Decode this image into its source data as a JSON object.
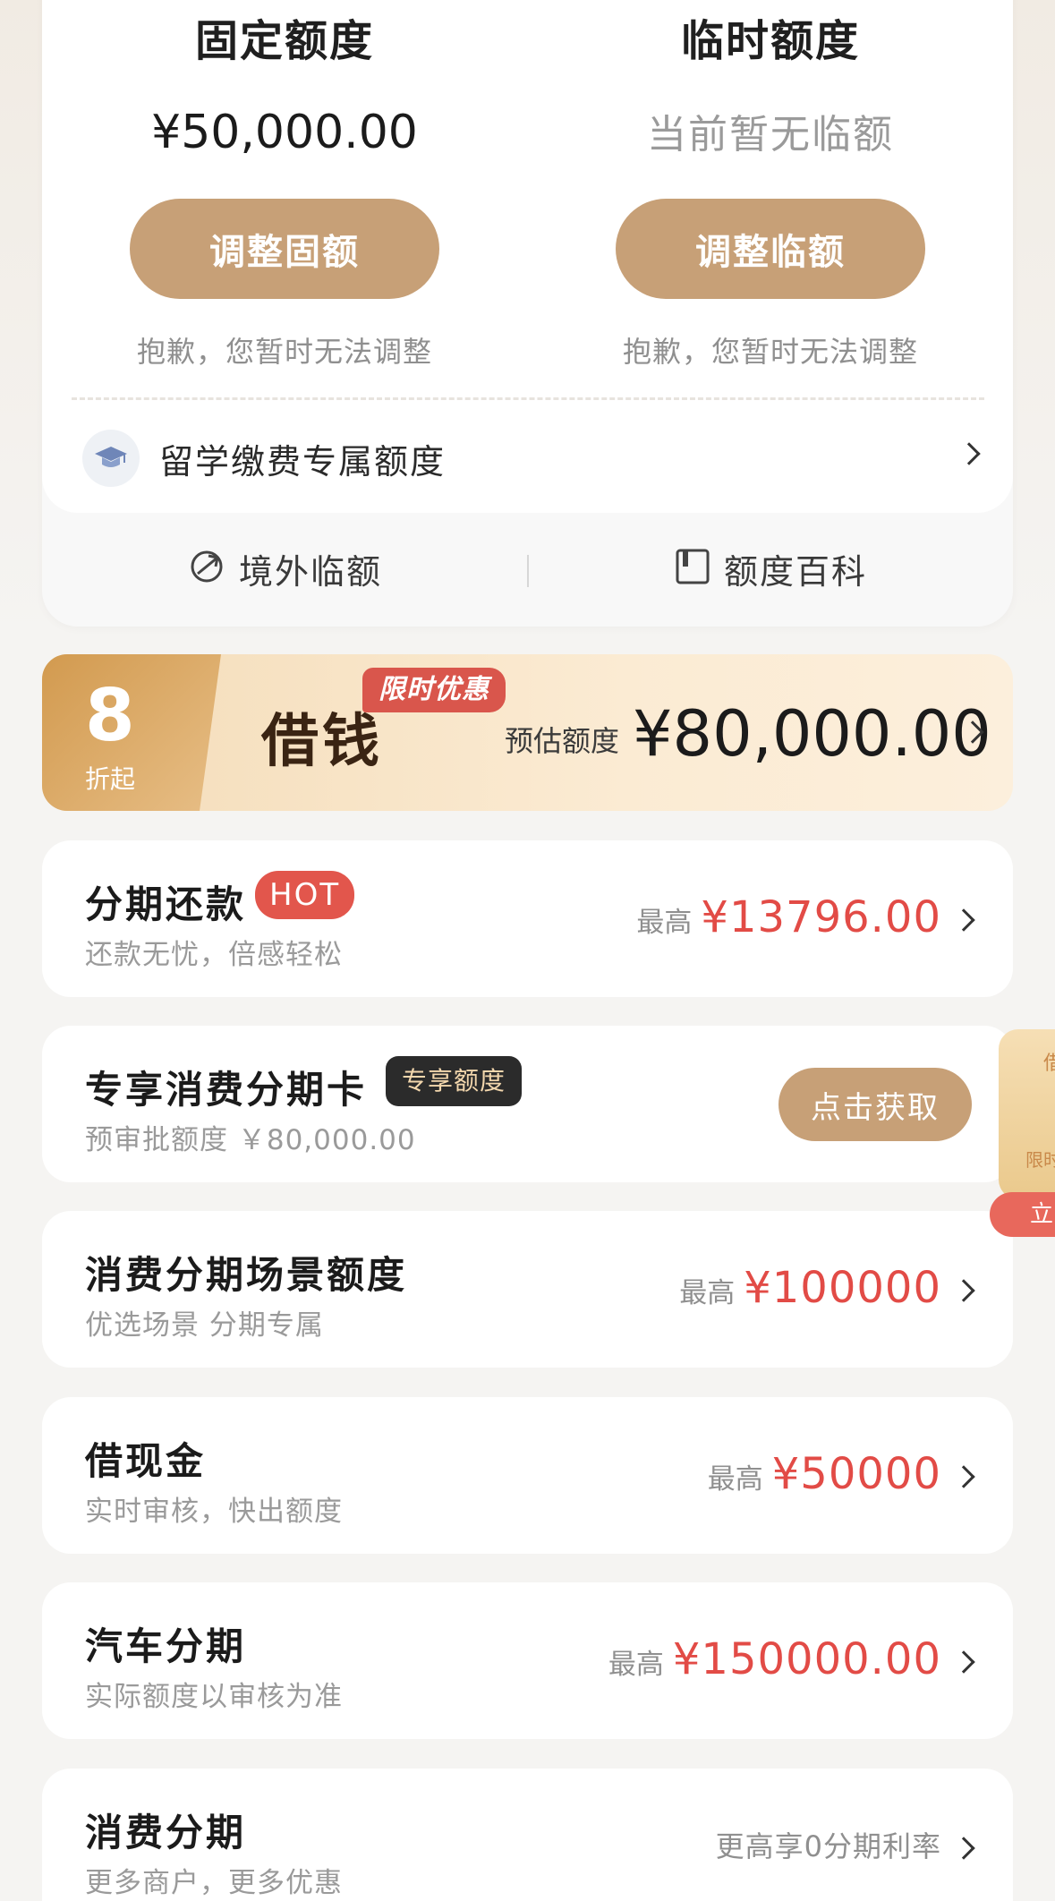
{
  "limits": {
    "fixed": {
      "title": "固定额度",
      "amount": "¥50,000.00",
      "button": "调整固额",
      "note": "抱歉，您暂时无法调整"
    },
    "temporary": {
      "title": "临时额度",
      "amount": "当前暂无临额",
      "button": "调整临额",
      "note": "抱歉，您暂时无法调整"
    },
    "study_row": {
      "label": "留学缴费专属额度",
      "icon": "graduation-cap-icon"
    },
    "quick_links": [
      {
        "label": "境外临额",
        "icon": "plane-globe-icon"
      },
      {
        "label": "额度百科",
        "icon": "book-icon"
      }
    ]
  },
  "loan_banner": {
    "discount_number": "8",
    "discount_label": "折起",
    "title": "借钱",
    "promo_badge": "限时优惠",
    "estimate_label": "预估额度",
    "estimate_value": "¥80,000.00"
  },
  "products": [
    {
      "title": "分期还款",
      "badge": "HOT",
      "subtitle": "还款无忧，倍感轻松",
      "right_label": "最高",
      "right_value": "¥13796.00"
    },
    {
      "title": "专享消费分期卡",
      "badge": "专享额度",
      "subtitle": "预审批额度 ￥80,000.00",
      "button": "点击获取"
    },
    {
      "title": "消费分期场景额度",
      "subtitle": "优选场景 分期专属",
      "right_label": "最高",
      "right_value": "¥100000"
    },
    {
      "title": "借现金",
      "subtitle": "实时审核，快出额度",
      "right_label": "最高",
      "right_value": "¥50000"
    },
    {
      "title": "汽车分期",
      "subtitle": "实际额度以审核为准",
      "right_label": "最高",
      "right_value": "¥150000.00"
    },
    {
      "title": "消费分期",
      "subtitle": "更多商户，更多优惠",
      "right_info": "更高享0分期利率"
    }
  ],
  "side_widget": {
    "top_text": "借",
    "mid_text": "限时",
    "pill_text": "立"
  },
  "colors": {
    "accent_gold": "#c7a077",
    "price_red": "#e24b46",
    "hot_red": "#e2564c",
    "background": "#f5f4f2"
  }
}
